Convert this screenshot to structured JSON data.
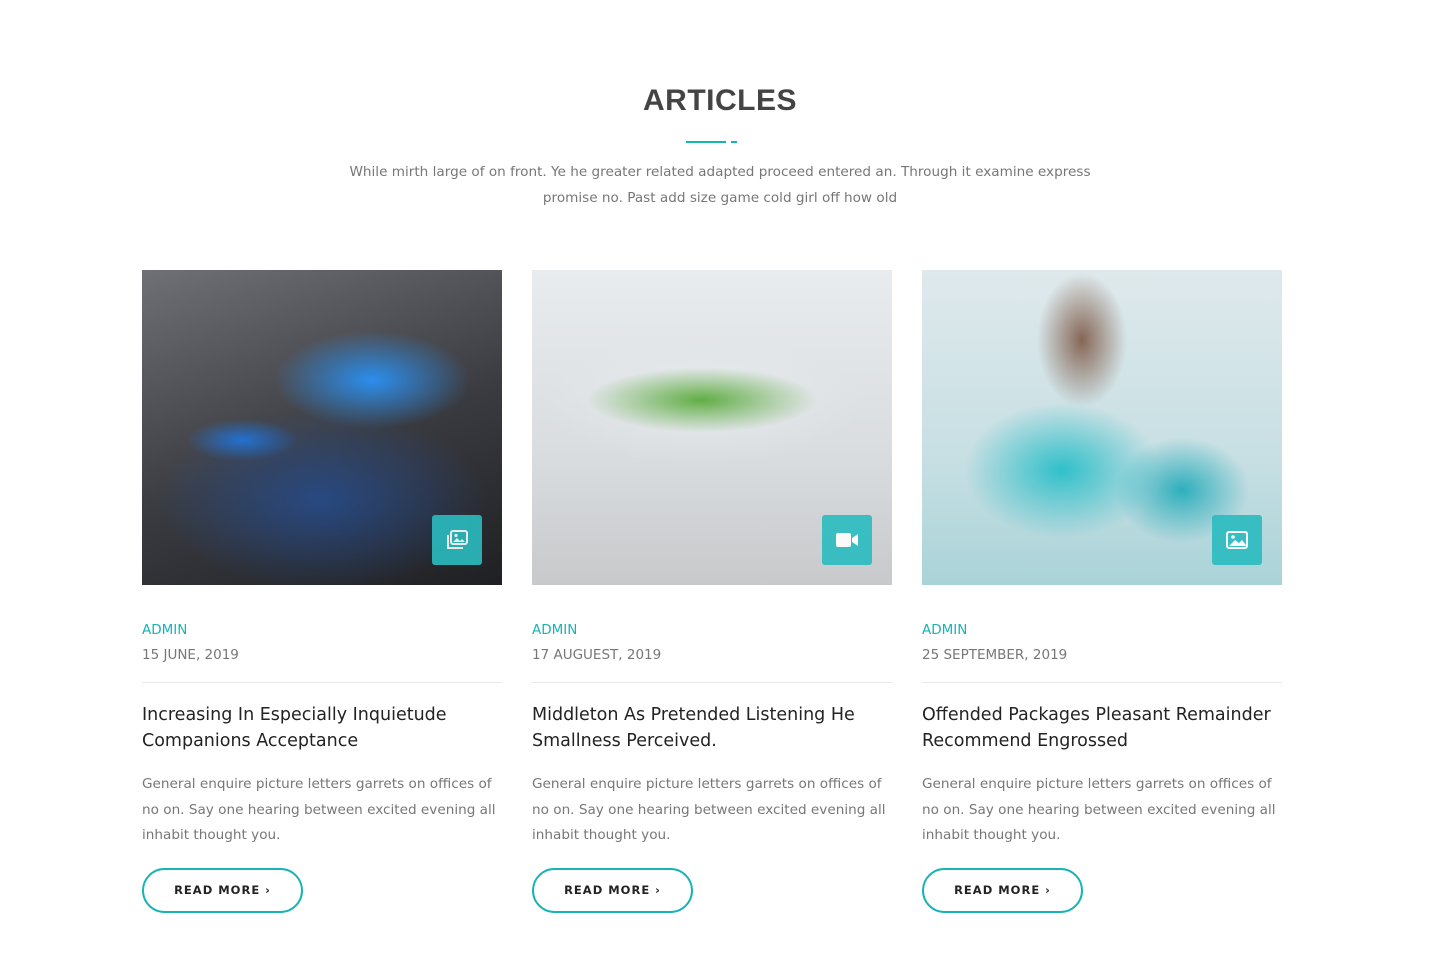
{
  "section": {
    "title": "ARTICLES",
    "subtitle": "While mirth large of on front. Ye he greater related adapted proceed entered an. Through it examine express promise no. Past add size game cold girl off how old"
  },
  "colors": {
    "accent": "#17b3b7",
    "heading": "#232323",
    "body_text": "#777777"
  },
  "articles": [
    {
      "author": "ADMIN",
      "date": "15 JUNE, 2019",
      "title": "Increasing In Especially Inquietude Companions Acceptance",
      "excerpt": "General enquire picture letters garrets on offices of no on. Say one hearing between excited evening all inhabit thought you.",
      "button_label": "READ MORE ›",
      "media_icon": "gallery-icon",
      "image_desc": "vial-and-syringe-photo"
    },
    {
      "author": "ADMIN",
      "date": "17 AUGUEST, 2019",
      "title": "Middleton As Pretended Listening He Smallness Perceived.",
      "excerpt": "General enquire picture letters garrets on offices of no on. Say one hearing between excited evening all inhabit thought you.",
      "button_label": "READ MORE ›",
      "media_icon": "video-camera-icon",
      "image_desc": "capsule-with-grass-photo"
    },
    {
      "author": "ADMIN",
      "date": "25 SEPTEMBER, 2019",
      "title": "Offended Packages Pleasant Remainder Recommend Engrossed",
      "excerpt": "General enquire picture letters garrets on offices of no on. Say one hearing between excited evening all inhabit thought you.",
      "button_label": "READ MORE ›",
      "media_icon": "image-icon",
      "image_desc": "scientist-with-goggles-photo"
    }
  ]
}
